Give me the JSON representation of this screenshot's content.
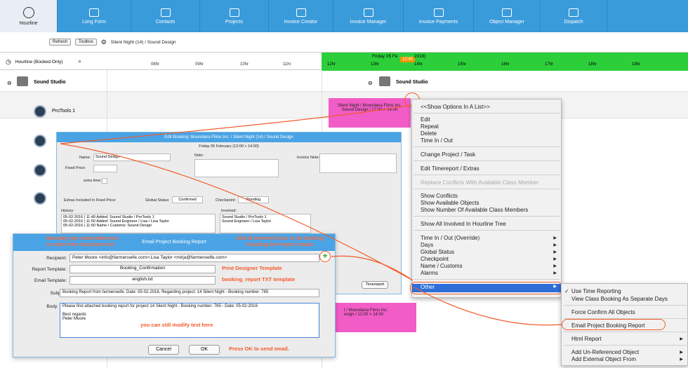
{
  "nav": [
    {
      "label": "Hourline",
      "icon": "clock-icon"
    },
    {
      "label": "Long Form",
      "icon": "list-icon"
    },
    {
      "label": "Contacts",
      "icon": "contacts-icon"
    },
    {
      "label": "Projects",
      "icon": "briefcase-icon"
    },
    {
      "label": "Invoice Creator",
      "icon": "invoice-icon"
    },
    {
      "label": "Invoice Manager",
      "icon": "bank-icon"
    },
    {
      "label": "Invoice Payments",
      "icon": "register-icon"
    },
    {
      "label": "Object Manager",
      "icon": "objects-icon"
    },
    {
      "label": "Dispatch",
      "icon": "dispatch-icon"
    }
  ],
  "toolbar": {
    "refresh": "Refresh",
    "toolbox": "Toolbox",
    "breadcrumb": "Silent Night (14) / Sound Design"
  },
  "timeline": {
    "view": "Hourline (Booked Only)",
    "hours_left": [
      "08hr",
      "09hr",
      "10hr",
      "11hr"
    ],
    "hours_right": [
      "12hr",
      "13hr",
      "14hr",
      "15hr",
      "16hr",
      "17hr",
      "18hr",
      "19hr"
    ],
    "date": "Friday 05 Fe",
    "date_tail": "2016)",
    "now": "12:45"
  },
  "rows": {
    "studio": "Sound Studio",
    "studio_right": "Sound Studio",
    "protools": "ProTools 1"
  },
  "booking": {
    "line1": "Silent Night / Moondana Films Inc.",
    "line2": "Sound Design / 12:00 > 14:00",
    "b2line1": "t / Moondana Films Inc.",
    "b2line2": "esign / 12:00 > 14:00"
  },
  "context_menu": {
    "show_list": "<<Show Options In A List>>",
    "edit": "Edit",
    "repeat": "Repeat",
    "delete": "Delete",
    "time_in_out": "Time In / Out",
    "change_project": "Change Project / Task",
    "edit_timereport": "Edit Timereport / Extras",
    "replace_conflicts": "Replace Conflicts With Available Class Member",
    "show_conflicts": "Show Conflicts",
    "show_available": "Show Available Objects",
    "show_number": "Show Number Of Available Class Members",
    "show_all": "Show All Involved In Hourline Tree",
    "time_override": "Time In / Out (Override)",
    "days": "Days",
    "global_status": "Global Status",
    "checkpoint": "Checkpoint",
    "name_customs": "Name / Customs",
    "alarms": "Alarms",
    "other": "Other"
  },
  "submenu": {
    "use_time": "Use Time Reporting",
    "view_class": "View Class Booking As Separate Days",
    "force_confirm": "Force Confirm All Objects",
    "email_report": "Email Project Booking Report",
    "html_report": "Html Report",
    "add_unref": "Add Un-Referenced Object",
    "add_external": "Add External Object From"
  },
  "edit_dialog": {
    "title": "Edit Booking: Moondana Films Inc. / Silent Night (14) / Sound Design",
    "subtitle": "Friday 05 February (12:00 > 14:00)",
    "name_label": "Name:",
    "name_value": "Sound Design",
    "note_label": "Note:",
    "invoice_note_label": "Invoice Note:",
    "fixed_price_label": "Fixed Price:",
    "extra_time_label": "extra time:",
    "extras_label": "Extras Included In Fixed Price:",
    "global_status_label": "Global Status:",
    "global_status_value": "Confirmed",
    "checkpoint_label": "Checkpoint:",
    "checkpoint_value": "Pending",
    "history_label": "History:",
    "involved_label": "Involved:",
    "history": [
      "05-02-2016 | 11:49  Added: Sound Studio / ProTools 1",
      "05-02-2016 | 11:50  Added: Sound Engineer / Lisa / Lisa Taylor",
      "05-02-2016 | 11:50  Name / Customs: Sound Design"
    ],
    "involved": [
      "Sound Studio / ProTools 1",
      "Sound Engineer / Lisa Taylor"
    ],
    "timereport": "Timereport"
  },
  "email_dialog": {
    "title": "Email Project Booking Report",
    "recipient_label": "Recipient:",
    "recipient_value": "Peter Moore <info@farmerswife.com>;Lisa Taylor <mirja@farmerswife.com>",
    "report_template_label": "Report Template:",
    "report_template_value": "Booking_Confirmation",
    "email_template_label": "Email Template:",
    "email_template_value": "english.txt",
    "subject_label": "Subject:",
    "subject_value": "Booking Report from farmerswife. Date: 05-02-2016, Regarding project: 14 Silent Night - Booking number: 765",
    "body_label": "Body:",
    "body_line1": "Please find attached booking report for project 14 Silent Night - Booking number: 765 - Date: 05-02-2016",
    "body_line2": "Best regards",
    "body_line3": "Peter Moore",
    "cancel": "Cancel",
    "ok": "OK"
  },
  "annotations": {
    "manual_l1": "Manually type email addresses",
    "manual_l2": "or select from drop down list",
    "involved_l1": "Add all involved Users in the Booking",
    "involved_l2": "including the Project Creator",
    "print_designer": "Print Designer Template",
    "txt_template": "booking_report TXT template",
    "modify": "you can still modify text here",
    "press_ok": "Press OK to send email."
  }
}
